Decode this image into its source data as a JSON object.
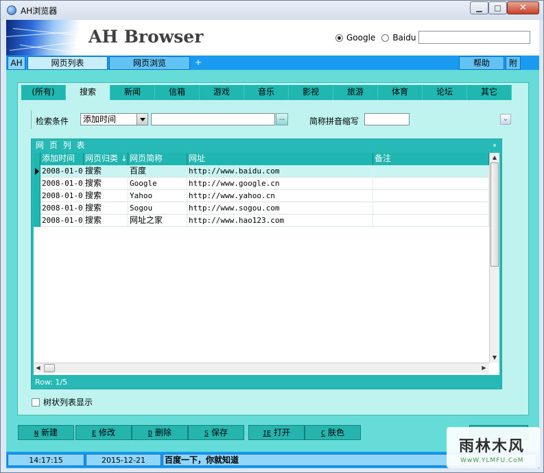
{
  "window": {
    "title": "AH浏览器",
    "min": "▁",
    "max": "□",
    "close": "✕"
  },
  "banner": {
    "brand": "AH Browser",
    "engines": [
      {
        "label": "Google",
        "selected": true
      },
      {
        "label": "Baidu",
        "selected": false
      }
    ],
    "search_value": ""
  },
  "nav": {
    "ah": "AH",
    "tab_list": "网页列表",
    "tab_browse": "网页浏览",
    "add": "+",
    "help": "帮助",
    "attach": "附"
  },
  "categories": [
    "(所有)",
    "搜索",
    "新闻",
    "信箱",
    "游戏",
    "音乐",
    "影视",
    "旅游",
    "体育",
    "论坛",
    "其它"
  ],
  "active_category": 1,
  "filter": {
    "label": "检索条件",
    "field_value": "添加时间",
    "query_value": "",
    "dots": "...",
    "pinyin_label": "简称拼音缩写",
    "pinyin_value": ""
  },
  "grid": {
    "title": "网 页 列 表",
    "columns": [
      "添加时间",
      "网页归类",
      "网页简称",
      "网址",
      "备注"
    ],
    "rows": [
      {
        "time": "2008-01-0",
        "cat": "搜索",
        "name": "百度",
        "url": "http://www.baidu.com",
        "note": ""
      },
      {
        "time": "2008-01-0",
        "cat": "搜索",
        "name": "Google",
        "url": "http://www.google.cn",
        "note": ""
      },
      {
        "time": "2008-01-0",
        "cat": "搜索",
        "name": "Yahoo",
        "url": "http://www.yahoo.cn",
        "note": ""
      },
      {
        "time": "2008-01-0",
        "cat": "搜索",
        "name": "Sogou",
        "url": "http://www.sogou.com",
        "note": ""
      },
      {
        "time": "2008-01-0",
        "cat": "搜索",
        "name": "网址之家",
        "url": "http://www.hao123.com",
        "note": ""
      }
    ],
    "footer": "Row: 1/5"
  },
  "tree_toggle": {
    "label": "树状列表显示",
    "checked": false
  },
  "actions": [
    {
      "key": "N",
      "label": "新建"
    },
    {
      "key": "E",
      "label": "修改"
    },
    {
      "key": "D",
      "label": "删除"
    },
    {
      "key": "S",
      "label": "保存"
    },
    {
      "key": "IE",
      "label": "打开"
    },
    {
      "key": "C",
      "label": "肤色"
    }
  ],
  "status": {
    "time": "14:17:15",
    "date": "2015-12-21",
    "message": "百度一下，你就知道"
  },
  "watermark": {
    "title": "雨林木风",
    "sub": "WwW.YLMFU.CoM"
  },
  "colors": {
    "nav_blue": "#1a9bf0",
    "teal": "#66dcd8",
    "teal_dark": "#20b7b0",
    "panel": "#bff3ef"
  }
}
